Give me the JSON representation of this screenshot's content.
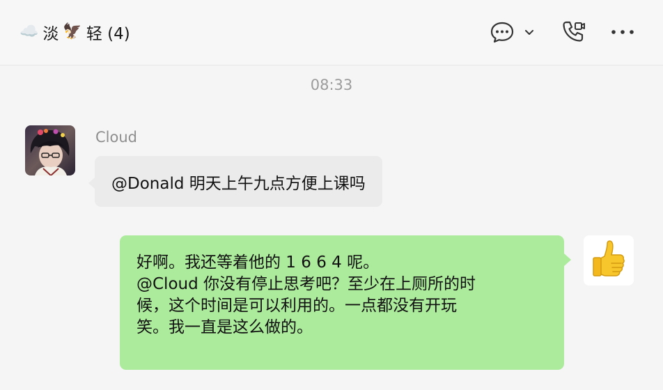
{
  "header": {
    "title_prefix_emoji": "☁️",
    "title_part1": "淡",
    "title_mid_emoji": "🦅",
    "title_part2": "轻 (4)"
  },
  "timestamp": "08:33",
  "messages": [
    {
      "sender": "Cloud",
      "text": "@Donald 明天上午九点方便上课吗"
    },
    {
      "lines": [
        "好啊。我还等着他的 1 6 6 4 呢。",
        " @Cloud 你没有停止思考吧？至少在上厕所的时",
        "候，这个时间是可以利用的。一点都没有开玩",
        "笑。我一直是这么做的。"
      ]
    }
  ],
  "icons": {
    "chat": "chat-bubble-icon",
    "dropdown": "chevron-down-icon",
    "call": "phone-video-icon",
    "more": "more-icon"
  },
  "colors": {
    "outgoing_bubble": "#acea9c",
    "incoming_bubble": "#ebebeb",
    "background": "#f5f5f5"
  }
}
